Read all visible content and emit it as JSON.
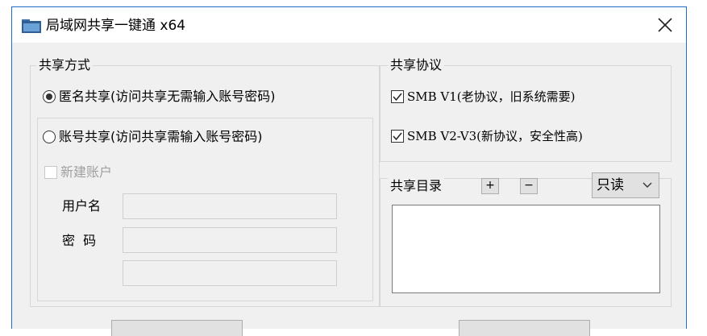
{
  "window": {
    "title": "局域网共享一键通 x64"
  },
  "share_mode": {
    "legend": "共享方式",
    "anonymous_label": "匿名共享(访问共享无需输入账号密码)",
    "account_label": "账号共享(访问共享需输入账号密码)",
    "new_account_label": "新建账户",
    "username_label": "用户名",
    "password_label": "密  码",
    "username_value": "",
    "password_value": "",
    "confirm_value": "",
    "selected": "anonymous"
  },
  "protocol": {
    "legend": "共享协议",
    "smb1_label": "SMB V1(老协议，旧系统需要)",
    "smb2_label": "SMB V2-V3(新协议，安全性高)",
    "smb1_checked": true,
    "smb2_checked": true
  },
  "share_dir": {
    "legend": "共享目录",
    "add_label": "+",
    "remove_label": "−",
    "permission": "只读",
    "permission_icon": "chevron-down-icon",
    "entries": []
  },
  "icons": {
    "app": "folder-icon",
    "close": "close-icon",
    "check": "checkmark-icon"
  },
  "colors": {
    "window_border": "#1e6fc8",
    "panel": "#f0f0f0",
    "titlebar": "#ffffff"
  }
}
